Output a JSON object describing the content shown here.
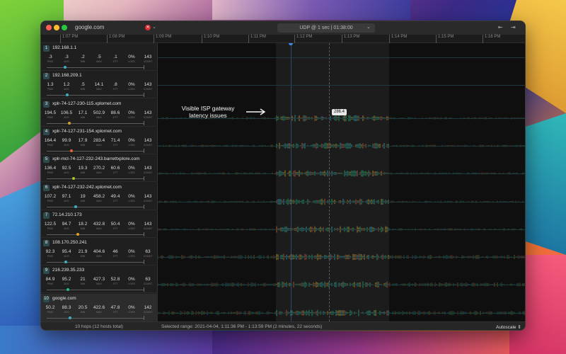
{
  "window": {
    "title": "google.com",
    "target_icon": "stop-icon",
    "dropdown_caret": "chevron-down-icon"
  },
  "session": {
    "label": "UDP @ 1 sec  |  01:38:00",
    "caret": "chevron-down-icon"
  },
  "toolbar": {
    "left_icon": "collapse-left-icon",
    "right_icon": "expand-right-icon",
    "left_glyph": "⇤",
    "right_glyph": "⇥"
  },
  "timeline": {
    "ticks": [
      "1:07 PM",
      "1:08 PM",
      "1:09 PM",
      "1:10 PM",
      "1:11 PM",
      "1:12 PM",
      "1:13 PM",
      "1:14 PM",
      "1:15 PM",
      "1:16 PM"
    ]
  },
  "stat_labels": [
    "PING",
    "AVG",
    "MIN",
    "MAX",
    "JITT",
    "LOSS",
    "COUNT"
  ],
  "hops": [
    {
      "num": "1",
      "name": "192.168.1.1",
      "stats": [
        ".3",
        ".3",
        ".2",
        ".5",
        ".1",
        "0%",
        "143"
      ]
    },
    {
      "num": "2",
      "name": "192.168.209.1",
      "stats": [
        "1.3",
        "1.2",
        ".5",
        "14.1",
        ".8",
        "0%",
        "143"
      ]
    },
    {
      "num": "3",
      "name": "xplr-74-127-230-115.xplornet.com",
      "stats": [
        "194.5",
        "106.5",
        "17.1",
        "502.9",
        "88.6",
        "0%",
        "143"
      ]
    },
    {
      "num": "4",
      "name": "xplr-74-127-231-154.xplornet.com",
      "stats": [
        "164.4",
        "99.9",
        "17.9",
        "283.4",
        "71.4",
        "0%",
        "143"
      ]
    },
    {
      "num": "5",
      "name": "xplr-mcl-74-127-232-243.barrettxplore.com",
      "stats": [
        "136.4",
        "92.5",
        "19.3",
        "270.2",
        "60.6",
        "0%",
        "143"
      ]
    },
    {
      "num": "6",
      "name": "xplr-74-127-232-242.xplornet.com",
      "stats": [
        "107.2",
        "97.1",
        "19",
        "458.2",
        "49.4",
        "0%",
        "143"
      ]
    },
    {
      "num": "7",
      "name": "72.14.210.173",
      "stats": [
        "122.5",
        "94.7",
        "18.2",
        "432.8",
        "50.4",
        "0%",
        "143"
      ]
    },
    {
      "num": "8",
      "name": "108.170.250.241",
      "stats": [
        "92.3",
        "95.4",
        "21.9",
        "404.6",
        "46",
        "0%",
        "63"
      ]
    },
    {
      "num": "9",
      "name": "216.239.35.233",
      "stats": [
        "84.9",
        "95.2",
        "21",
        "427.3",
        "52.8",
        "0%",
        "63"
      ]
    },
    {
      "num": "10",
      "name": "google.com",
      "stats": [
        "50.2",
        "88.3",
        "20.5",
        "422.6",
        "47.8",
        "0%",
        "142"
      ]
    }
  ],
  "chart": {
    "hover_value": "286.4",
    "accent": "#3c8ff0",
    "selected_color": "#1c1c1c"
  },
  "annotation": {
    "text": "Visible ISP gateway latency issues"
  },
  "status": {
    "hops": "10 hops (12 hosts total)",
    "range": "Selected range: 2021-04-04, 1:11:36 PM - 1:13:59 PM (2 minutes, 22 seconds)",
    "autoscale": "Autoscale ⇕"
  }
}
